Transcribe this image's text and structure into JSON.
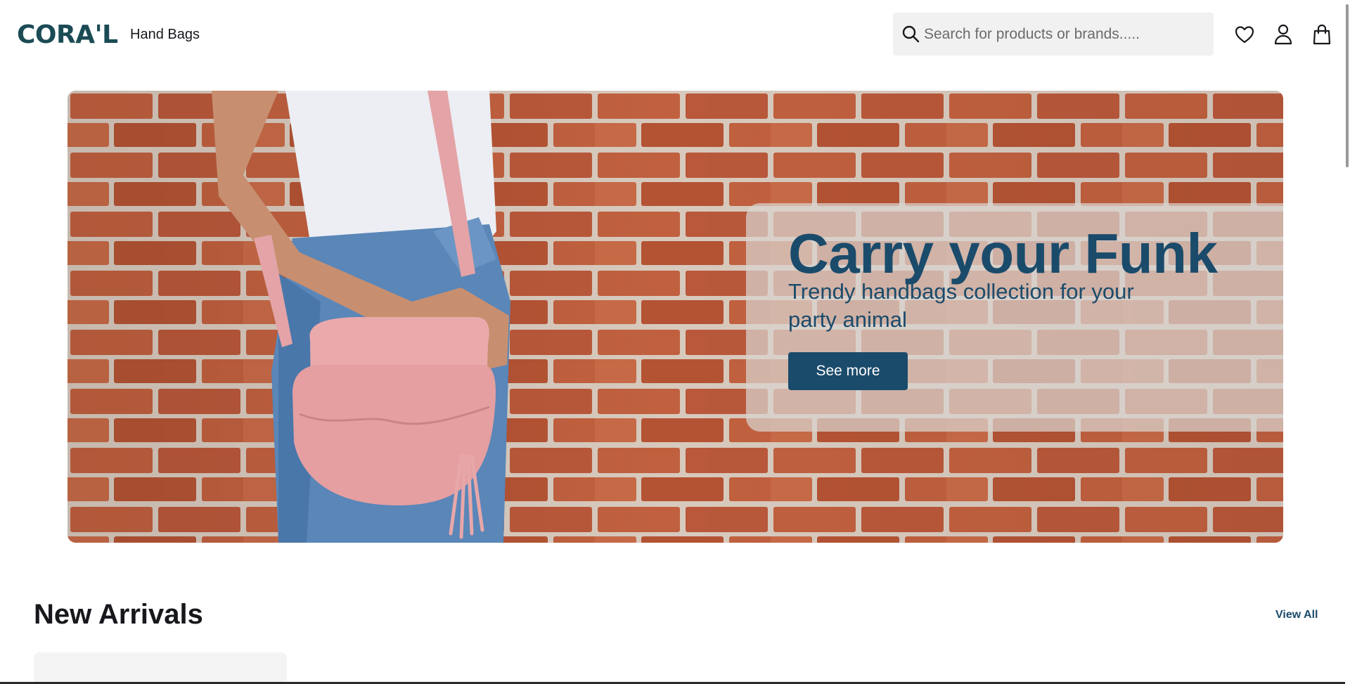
{
  "header": {
    "logo_text": "CORA'L",
    "nav_link": "Hand Bags",
    "search_placeholder": "Search for products or brands.....",
    "icons": [
      "search-icon",
      "heart-icon",
      "user-icon",
      "shopping-bag-icon"
    ]
  },
  "hero": {
    "title": "Carry your Funk",
    "subtitle": "Trendy handbags collection for your party animal",
    "button_label": "See more"
  },
  "new_arrivals": {
    "title": "New Arrivals",
    "view_all_label": "View All"
  },
  "colors": {
    "brand": "#1b4b55",
    "accent": "#1b4b6b",
    "search_bg": "#f1f1f1"
  }
}
